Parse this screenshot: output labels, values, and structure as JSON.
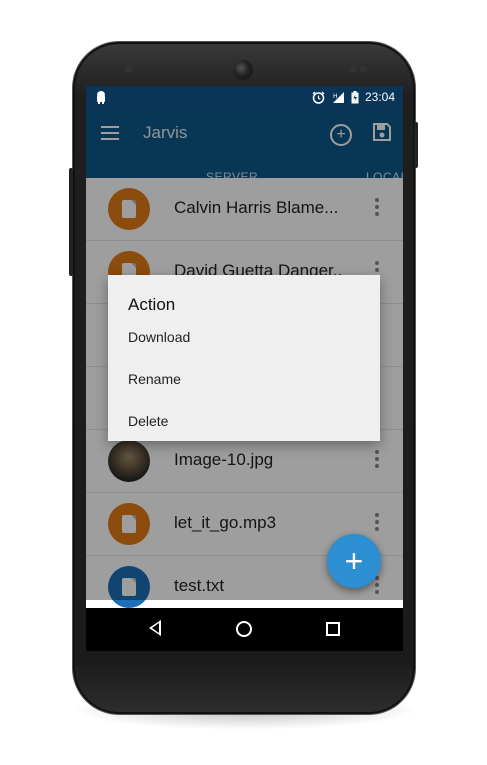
{
  "status_bar": {
    "time": "23:04"
  },
  "toolbar": {
    "title": "Jarvis"
  },
  "tabs": [
    {
      "label": "SERVER"
    },
    {
      "label": "LOCAL"
    }
  ],
  "files": [
    {
      "name": "Calvin Harris Blame...",
      "type": "audio",
      "avatar_color": "#e07b18"
    },
    {
      "name": "David Guetta Danger..",
      "type": "audio",
      "avatar_color": "#e07b18"
    },
    {
      "name": "",
      "type": "hidden",
      "avatar_color": "#e07b18"
    },
    {
      "name": "",
      "type": "hidden",
      "avatar_color": "#e07b18"
    },
    {
      "name": "Image-10.jpg",
      "type": "image",
      "avatar_color": "#555555"
    },
    {
      "name": "let_it_go.mp3",
      "type": "audio",
      "avatar_color": "#e07b18"
    },
    {
      "name": "test.txt",
      "type": "text",
      "avatar_color": "#1c6fb5"
    }
  ],
  "dialog": {
    "title": "Action",
    "items": [
      "Download",
      "Rename",
      "Delete"
    ]
  },
  "fab": {
    "icon": "plus-icon"
  },
  "colors": {
    "status_bar": "#0b3558",
    "toolbar": "#0e5a8a",
    "fab": "#2c8fd2",
    "audio_avatar": "#e07b18",
    "text_avatar": "#1c6fb5"
  }
}
